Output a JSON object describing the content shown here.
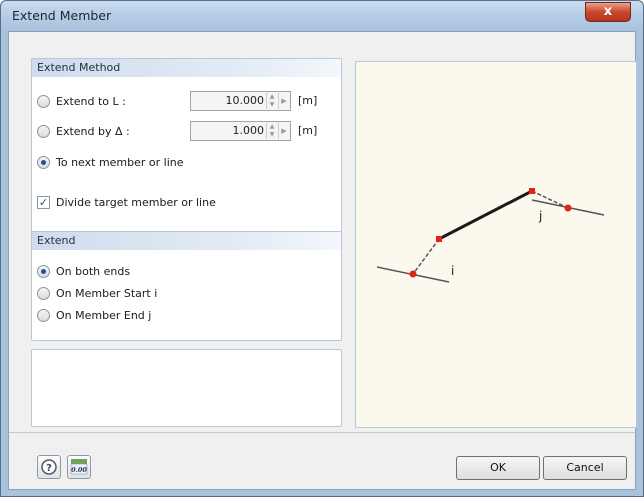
{
  "window": {
    "title": "Extend Member",
    "close_label": "x"
  },
  "extend_method": {
    "header": "Extend Method",
    "extend_to_label": "Extend to L :",
    "extend_to_value": "10.000",
    "extend_to_unit": "[m]",
    "extend_by_label": "Extend by Δ :",
    "extend_by_value": "1.000",
    "extend_by_unit": "[m]",
    "next_member_label": "To next member or line",
    "divide_label": "Divide target member or line",
    "selected": "To next member or line",
    "divide_checked": true
  },
  "extend": {
    "header": "Extend",
    "options": [
      "On both ends",
      "On Member Start i",
      "On Member End j"
    ],
    "selected": "On both ends"
  },
  "preview": {
    "label_i": "i",
    "label_j": "j",
    "member_color": "#1a1a1a",
    "node_color": "#e0241c",
    "extension_color": "#555555"
  },
  "footer": {
    "ok_label": "OK",
    "cancel_label": "Cancel",
    "help_icon": "help-icon",
    "units_icon": "decimal-places-icon",
    "units_icon_text": "0.00"
  }
}
